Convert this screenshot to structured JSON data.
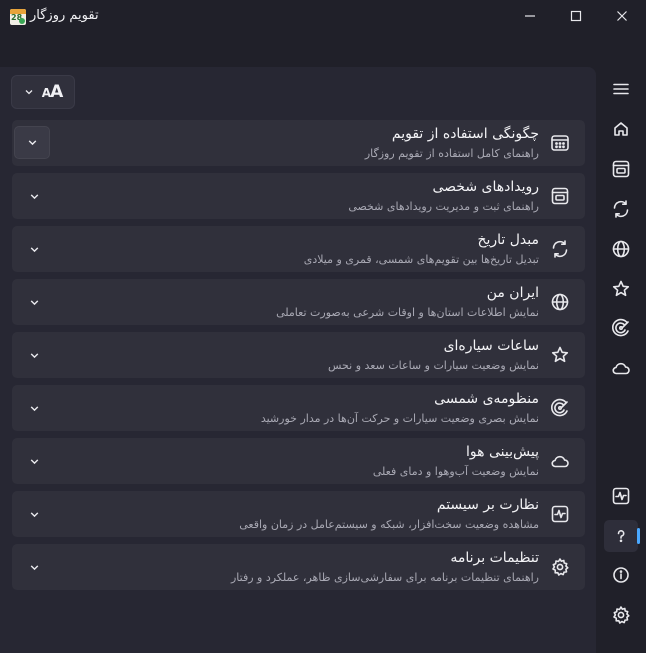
{
  "window": {
    "title": "تقویم روزگار",
    "app_icon_number": "28"
  },
  "toolbar": {
    "font_size_label": "AA",
    "font_size_icon": "text-size-icon"
  },
  "cards": [
    {
      "title": "چگونگی استفاده از تقویم",
      "subtitle": "راهنمای کامل استفاده از تقویم روزگار",
      "icon": "calendar-grid-icon",
      "expanded_hover": true
    },
    {
      "title": "رویدادهای شخصی",
      "subtitle": "راهنمای ثبت و مدیریت رویدادهای شخصی",
      "icon": "calendar-event-icon"
    },
    {
      "title": "مبدل تاریخ",
      "subtitle": "تبدیل تاریخ‌ها بین تقویم‌های شمسی، قمری و میلادی",
      "icon": "convert-arrows-icon"
    },
    {
      "title": "ایران من",
      "subtitle": "نمایش اطلاعات استان‌ها و اوقات شرعی به‌صورت تعاملی",
      "icon": "globe-icon"
    },
    {
      "title": "ساعات سیاره‌ای",
      "subtitle": "نمایش وضعیت سیارات و ساعات سعد و نحس",
      "icon": "star-icon"
    },
    {
      "title": "منظومه‌ی شمسی",
      "subtitle": "نمایش بصری وضعیت سیارات و حرکت آن‌ها در مدار خورشید",
      "icon": "orbit-icon"
    },
    {
      "title": "پیش‌بینی هوا",
      "subtitle": "نمایش وضعیت آب‌وهوا و دمای فعلی",
      "icon": "cloud-icon"
    },
    {
      "title": "نظارت بر سیستم",
      "subtitle": "مشاهده وضعیت سخت‌افزار، شبکه و سیستم‌عامل در زمان واقعی",
      "icon": "activity-monitor-icon"
    },
    {
      "title": "تنظیمات برنامه",
      "subtitle": "راهنمای تنظیمات برنامه برای سفارشی‌سازی ظاهر، عملکرد و رفتار",
      "icon": "gear-icon"
    }
  ],
  "nav_rail": [
    "menu-icon",
    "home-icon",
    "calendar-event-icon",
    "convert-arrows-icon",
    "globe-icon",
    "star-icon",
    "orbit-icon",
    "cloud-icon",
    "activity-monitor-icon",
    "help-icon",
    "info-icon",
    "gear-icon"
  ],
  "nav_active": "help-icon",
  "colors": {
    "background": "#202029",
    "panel": "#272733",
    "card": "#30303b",
    "accent": "#4aa8ff",
    "text": "#f3f3f6",
    "subtext": "#a9a9b4"
  }
}
